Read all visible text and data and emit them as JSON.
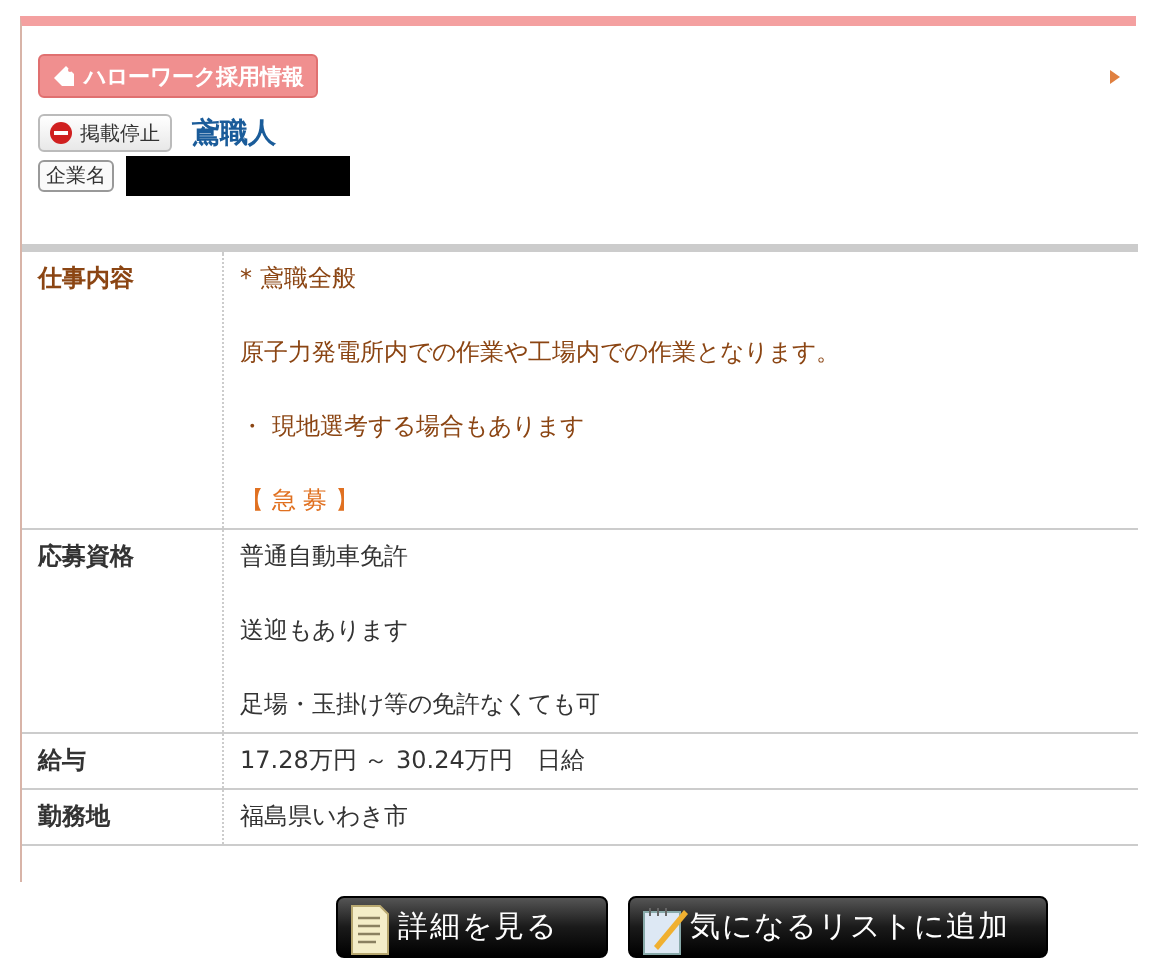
{
  "source_badge": "ハローワーク採用情報",
  "status_badge": "掲載停止",
  "job_title": "鳶職人",
  "company_label": "企業名",
  "company_redacted": true,
  "details": [
    {
      "label": "仕事内容",
      "highlighted": true,
      "lines": [
        "* 鳶職全般",
        "原子力発電所内での作業や工場内での作業となります。",
        "・ 現地選考する場合もあります"
      ],
      "urgent_label": "【 急 募 】"
    },
    {
      "label": "応募資格",
      "highlighted": false,
      "lines": [
        "普通自動車免許",
        "送迎もあります",
        "足場・玉掛け等の免許なくても可"
      ]
    },
    {
      "label": "給与",
      "highlighted": false,
      "lines": [
        "17.28万円 ～ 30.24万円　日給"
      ]
    },
    {
      "label": "勤務地",
      "highlighted": false,
      "lines": [
        "福島県いわき市"
      ]
    }
  ],
  "buttons": [
    {
      "label": "詳細を見る",
      "kind": "details"
    },
    {
      "label": "気になるリストに追加",
      "kind": "favorite"
    }
  ]
}
